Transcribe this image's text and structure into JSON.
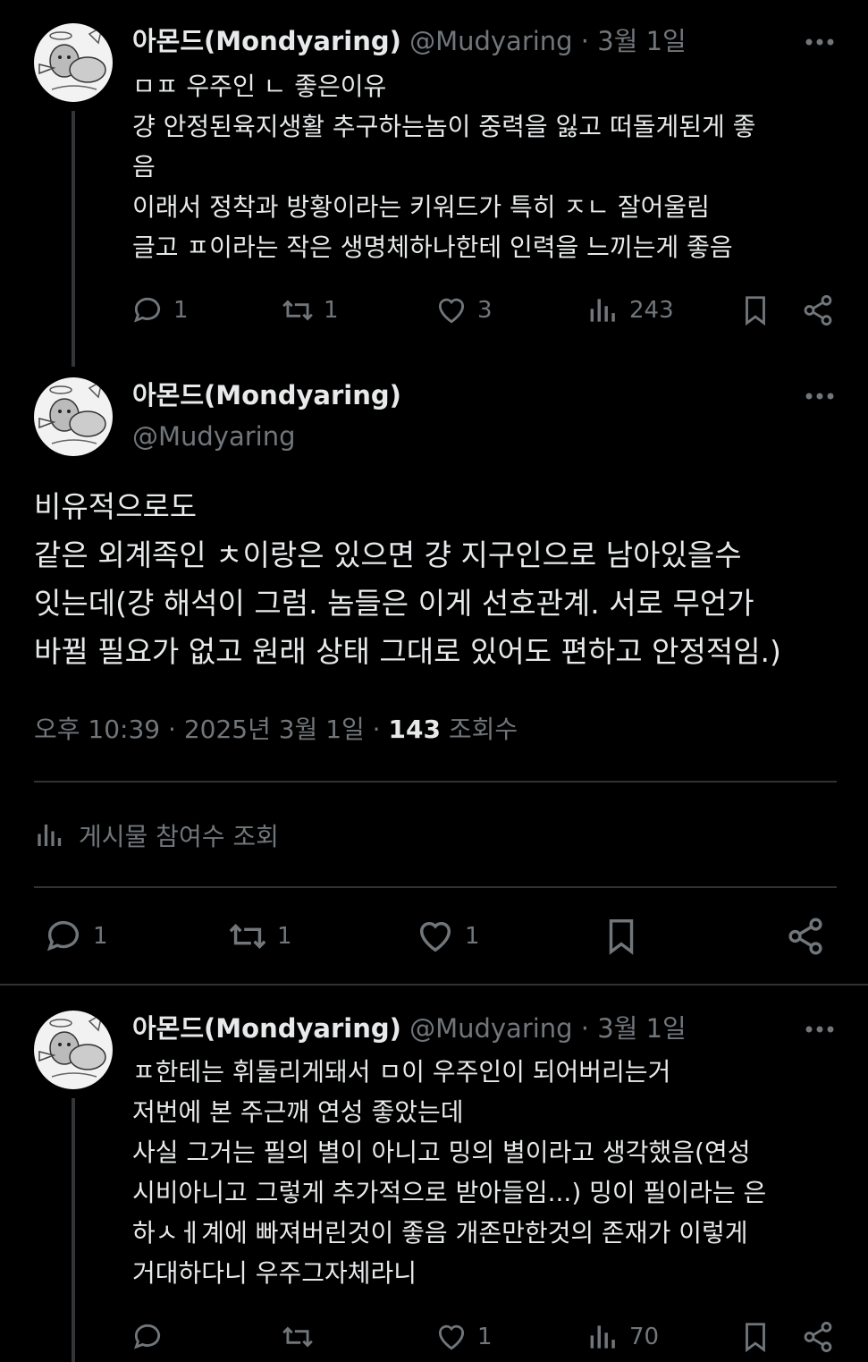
{
  "colors": {
    "background": "#000000",
    "text": "#e7e9ea",
    "muted": "#71767b",
    "divider": "#2f3336"
  },
  "tweet1": {
    "name": "아몬드(Mondyaring)",
    "meta": "@Mudyaring · 3월 1일",
    "text": "ㅁㅍ 우주인 ㄴ 좋은이유\n걍 안정된육지생활 추구하는놈이 중력을 잃고 떠돌게된게 좋\n음\n이래서 정착과 방황이라는 키워드가 특히 ㅈㄴ 잘어울림\n글고 ㅍ이라는 작은 생명체하나한테 인력을 느끼는게 좋음",
    "replies": "1",
    "retweets": "1",
    "likes": "3",
    "views": "243"
  },
  "main": {
    "name": "아몬드(Mondyaring)",
    "handle": "@Mudyaring",
    "text": "비유적으로도\n같은 외계족인 ㅊ이랑은 있으면 걍 지구인으로 남아있을수\n잇는데(걍 해석이 그럼. 놈들은 이게 선호관계. 서로 무언가\n바뀔 필요가 없고 원래 상태 그대로 있어도 편하고 안정적임.)",
    "time": "오후 10:39 · 2025년 3월 1일 ·",
    "views_count": "143",
    "views_label": "조회수",
    "engagement_label": "게시물 참여수 조회",
    "replies": "1",
    "retweets": "1",
    "likes": "1"
  },
  "tweet3": {
    "name": "아몬드(Mondyaring)",
    "meta": "@Mudyaring · 3월 1일",
    "text": "ㅍ한테는 휘둘리게돼서 ㅁ이 우주인이 되어버리는거\n저번에 본 주근깨 연성 좋았는데\n사실 그거는 필의 별이 아니고 밍의 별이라고 생각했음(연성\n시비아니고 그렇게 추가적으로 받아들임...) 밍이 필이라는 은\n하ㅅㅔ계에 빠져버린것이 좋음 개존만한것의 존재가 이렇게\n거대하다니 우주그자체라니",
    "replies": "",
    "retweets": "",
    "likes": "1",
    "views": "70"
  },
  "icons": [
    "more-icon",
    "reply-icon",
    "retweet-icon",
    "like-icon",
    "views-icon",
    "bookmark-icon",
    "share-icon",
    "avatar"
  ]
}
